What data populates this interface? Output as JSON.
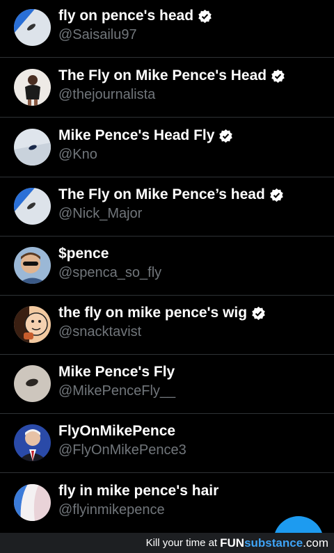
{
  "accounts": [
    {
      "name": "fly on pence's head",
      "handle": "@Saisailu97",
      "verified": true,
      "avatar": "fly-on-hair-avatar"
    },
    {
      "name": "The Fly on Mike Pence's Head",
      "handle": "@thejournalista",
      "verified": true,
      "avatar": "person-photo-avatar"
    },
    {
      "name": "Mike Pence's Head Fly",
      "handle": "@Kno",
      "verified": true,
      "avatar": "fly-on-hair-avatar"
    },
    {
      "name": "The Fly on Mike Pence’s head",
      "handle": "@Nick_Major",
      "verified": true,
      "avatar": "fly-on-hair-avatar"
    },
    {
      "name": "$pence",
      "handle": "@spenca_so_fly",
      "verified": false,
      "avatar": "sunglasses-kid-avatar"
    },
    {
      "name": "the fly on mike pence's wig",
      "handle": "@snacktavist",
      "verified": true,
      "avatar": "cartoon-face-avatar"
    },
    {
      "name": "Mike Pence's Fly",
      "handle": "@MikePenceFly__",
      "verified": false,
      "avatar": "fly-closeup-avatar"
    },
    {
      "name": "FlyOnMikePence",
      "handle": "@FlyOnMikePence3",
      "verified": false,
      "avatar": "mike-pence-avatar"
    },
    {
      "name": "fly in mike pence's hair",
      "handle": "@flyinmikepence",
      "verified": false,
      "avatar": "white-hair-avatar"
    }
  ],
  "footer": {
    "prefix": "Kill your time at",
    "brand_fun": "FUN",
    "brand_sub": "substance",
    "brand_com": ".com"
  },
  "colors": {
    "background": "#000000",
    "handle": "#71767b",
    "verified": "#ffffff",
    "fab": "#1d9bf0"
  }
}
